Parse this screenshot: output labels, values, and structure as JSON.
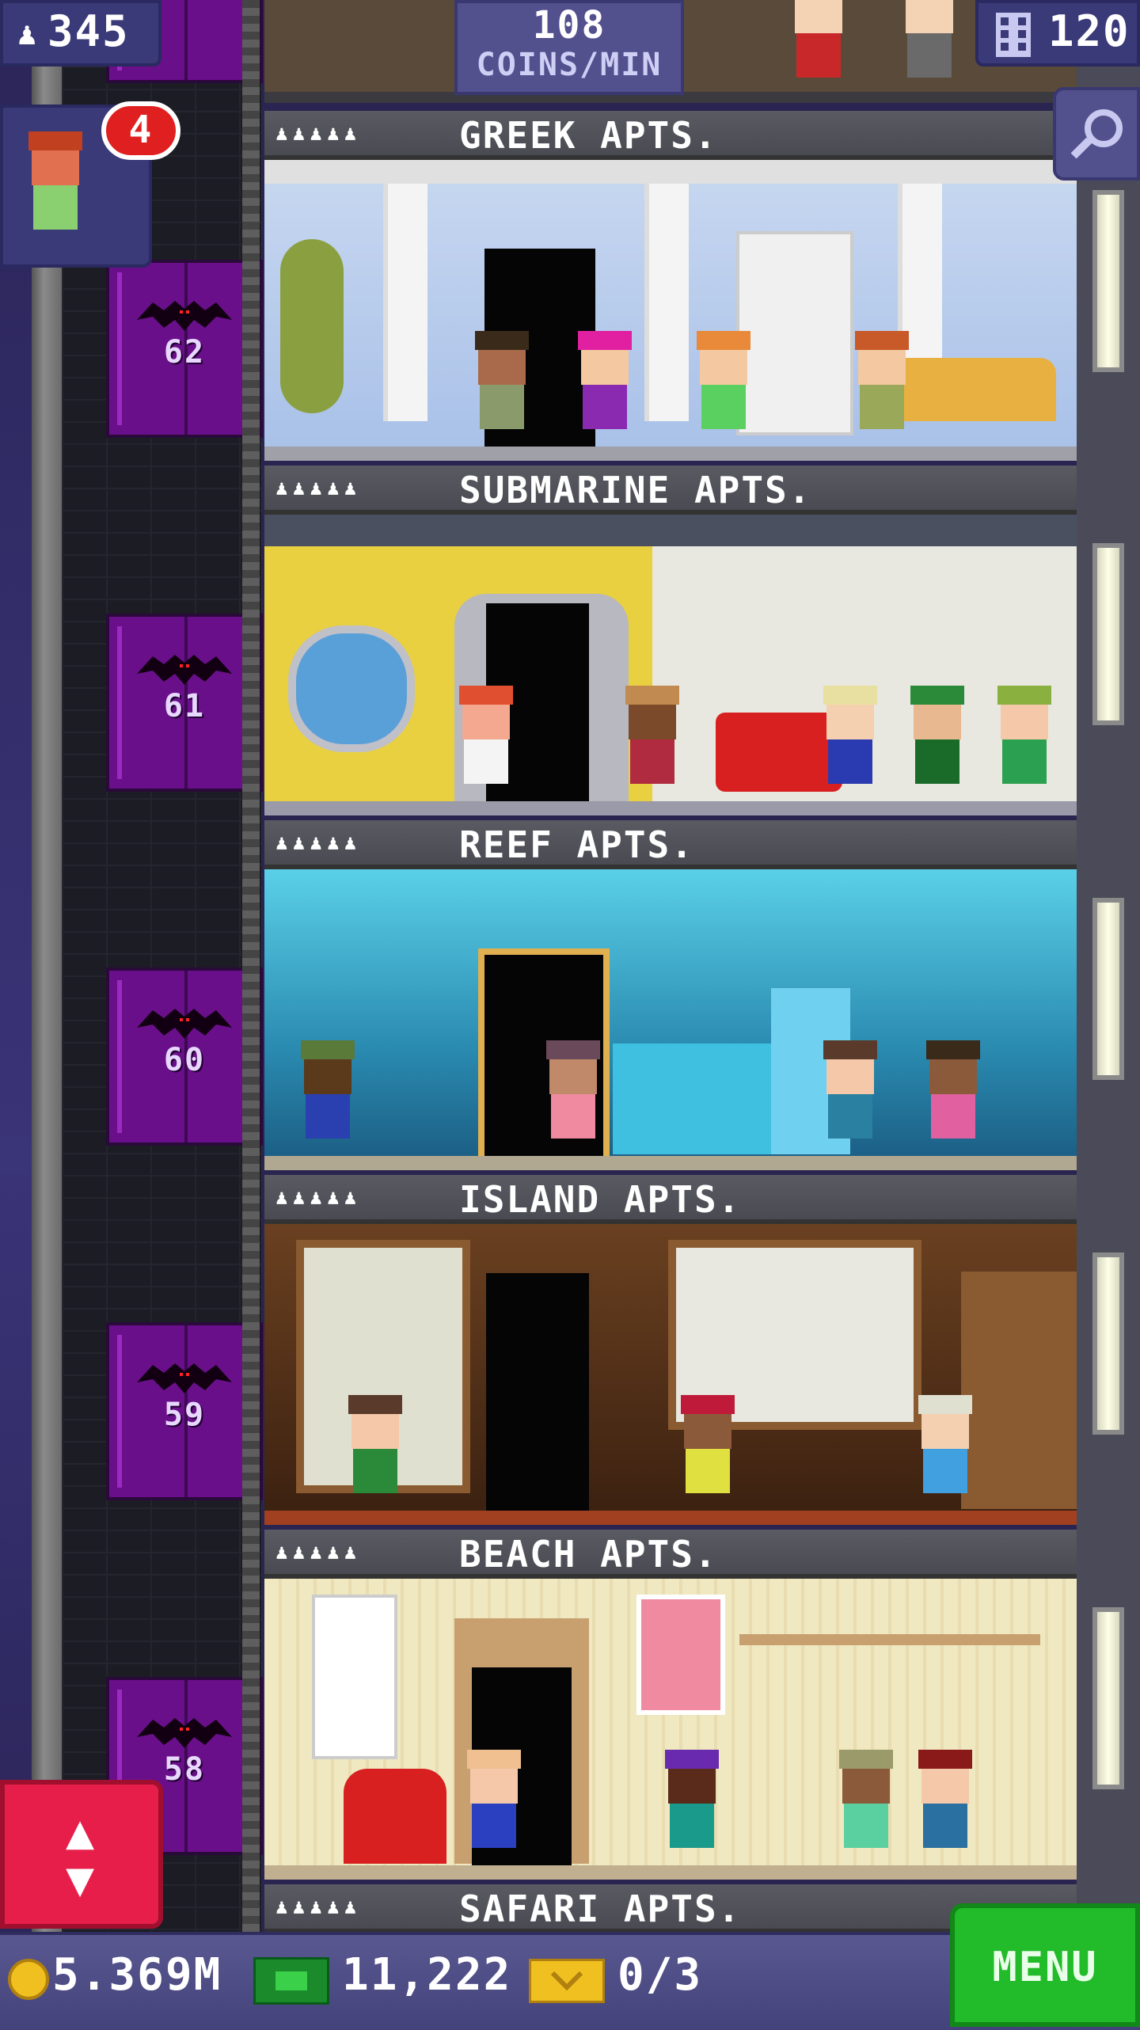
{
  "hud": {
    "population": "345",
    "coins_per_min_value": "108",
    "coins_per_min_unit": "COINS/MIN",
    "floors": "120",
    "notification_count": "4"
  },
  "floors": [
    {
      "name": "GREEK APTS.",
      "number": "62",
      "residents_icon": "♟♟♟♟♟"
    },
    {
      "name": "SUBMARINE APTS.",
      "number": "61",
      "residents_icon": "♟♟♟♟♟"
    },
    {
      "name": "REEF APTS.",
      "number": "60",
      "residents_icon": "♟♟♟♟♟"
    },
    {
      "name": "ISLAND APTS.",
      "number": "59",
      "residents_icon": "♟♟♟♟♟"
    },
    {
      "name": "BEACH APTS.",
      "number": "58",
      "residents_icon": "♟♟♟♟♟"
    },
    {
      "name": "SAFARI APTS.",
      "number": "",
      "residents_icon": "♟♟♟♟♟"
    }
  ],
  "bottom": {
    "coins": "5.369M",
    "bux": "11,222",
    "tickets": "0/3",
    "menu_label": "MENU"
  },
  "icons": {
    "population": "person-icon",
    "floors": "building-icon",
    "search": "magnifier-icon",
    "elevator": "up-down-arrows-icon",
    "coin": "coin-icon",
    "bux": "bux-icon",
    "ticket": "golden-ticket-icon"
  },
  "colors": {
    "hud_bg": "#3b3a78",
    "elevator_door": "#6a0f8a",
    "elevator_button": "#e81e4a",
    "menu_button": "#22bb2a",
    "badge": "#e02020"
  }
}
